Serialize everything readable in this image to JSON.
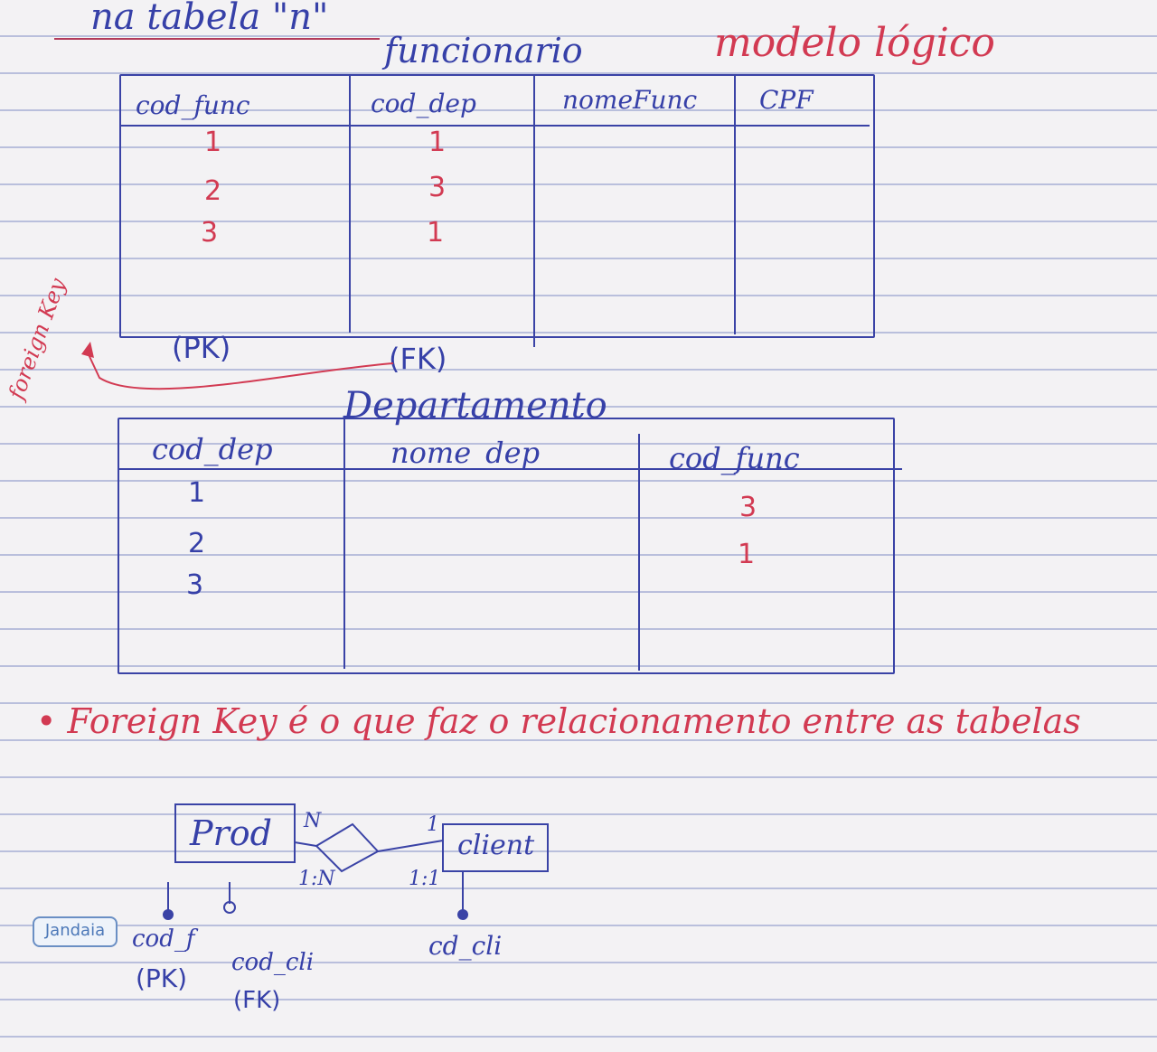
{
  "top_note": "na tabela \"n\"",
  "funcionario": {
    "title": "funcionario",
    "headers": [
      "cod_func",
      "cod_dep",
      "nomeFunc",
      "CPF"
    ],
    "col1": [
      "1",
      "2",
      "3"
    ],
    "col2": [
      "1",
      "3",
      "1"
    ],
    "pk_label": "(PK)",
    "fk_label": "(FK)"
  },
  "side_note": "modelo lógico",
  "foreign_key_note": "foreign Key",
  "departamento": {
    "title": "Departamento",
    "headers": [
      "cod_dep",
      "nome_dep",
      "cod_func"
    ],
    "col1": [
      "1",
      "2",
      "3"
    ],
    "col3": [
      "3",
      "1"
    ]
  },
  "fk_sentence": "• Foreign Key é o que faz o relacionamento entre as tabelas",
  "diagram": {
    "entity_left": "Prod",
    "entity_right": "client",
    "card_left_top": "N",
    "card_right_top": "1",
    "card_left_bottom": "1:N",
    "card_right_bottom": "1:1",
    "attr1": "cod_f",
    "attr1_key": "(PK)",
    "attr2": "cod_cli",
    "attr2_key": "(FK)",
    "attr3": "cd_cli"
  },
  "brand": "Jandaia",
  "colors": {
    "blue_ink": "#3640a8",
    "red_ink": "#d23a52"
  }
}
